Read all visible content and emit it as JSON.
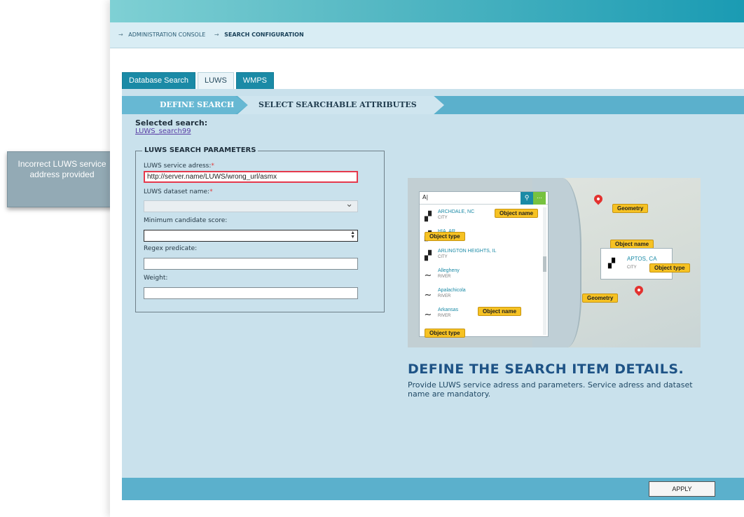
{
  "breadcrumb": {
    "items": [
      {
        "label": "ADMINISTRATION CONSOLE",
        "bold": false
      },
      {
        "label": "SEARCH CONFIGURATION",
        "bold": true
      }
    ],
    "separator": "→"
  },
  "tabs": [
    {
      "label": "Database Search",
      "active": false
    },
    {
      "label": "LUWS",
      "active": true
    },
    {
      "label": "WMPS",
      "active": false
    }
  ],
  "steps": [
    {
      "label": "DEFINE SEARCH",
      "active": false
    },
    {
      "label": "SELECT SEARCHABLE ATTRIBUTES",
      "active": true
    }
  ],
  "selected_search": {
    "label": "Selected search:",
    "value": "LUWS_search99"
  },
  "form": {
    "legend": "LUWS SEARCH PARAMETERS",
    "service_address_label": "LUWS service adress:",
    "service_address_value": "http://server.name/LUWS/wrong_url/asmx",
    "dataset_label": "LUWS dataset name:",
    "dataset_value": "",
    "min_score_label": "Minimum candidate score:",
    "min_score_value": "",
    "regex_label": "Regex predicate:",
    "regex_value": "",
    "weight_label": "Weight:",
    "weight_value": "",
    "required_mark": "*"
  },
  "callout": {
    "text": "Incorrect LUWS service address provided"
  },
  "illustration": {
    "search_query": "A|",
    "results": [
      {
        "name": "ARCHDALE, NC",
        "type": "CITY",
        "icon": "buildings-icon"
      },
      {
        "name": "HIA, AR",
        "type": "CITY",
        "icon": "buildings-icon"
      },
      {
        "name": "ARLINGTON HEIGHTS, IL",
        "type": "CITY",
        "icon": "buildings-icon"
      },
      {
        "name": "Allegheny",
        "type": "RIVER",
        "icon": "river-icon"
      },
      {
        "name": "Apalachicola",
        "type": "RIVER",
        "icon": "river-icon"
      },
      {
        "name": "Arkansas",
        "type": "RIVER",
        "icon": "river-icon"
      }
    ],
    "highlight": {
      "name": "APTOS, CA",
      "type": "CITY"
    },
    "tags": {
      "object_name": "Object name",
      "object_type": "Object type",
      "geometry": "Geometry"
    }
  },
  "info": {
    "headline": "DEFINE THE SEARCH ITEM DETAILS.",
    "description": "Provide LUWS service adress and parameters. Service adress and dataset name are mandatory."
  },
  "footer": {
    "apply_label": "APPLY"
  },
  "colors": {
    "accent": "#1a8aa6",
    "panel": "#c9e1ec",
    "error": "#e5394c",
    "tag": "#f6c223",
    "pin": "#e3322f"
  }
}
